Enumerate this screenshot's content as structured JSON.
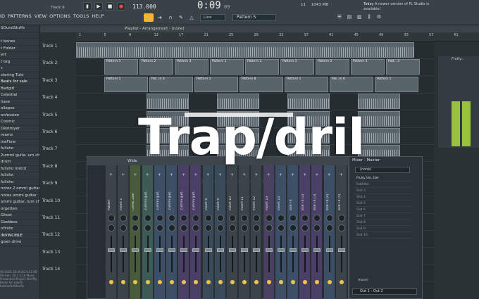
{
  "menu": [
    "ID",
    "PATTERNS",
    "VIEW",
    "OPTIONS",
    "TOOLS",
    "HELP"
  ],
  "top": {
    "track_hint": "Track 9",
    "bpm": "113.000",
    "time": "0:09",
    "time_sub": "09",
    "pattern": "Pattern 5",
    "mode": "Line",
    "cpu_memory": "1043 MB",
    "cpu_counter": "11",
    "news_label": "Today",
    "news_text": "A newer version of FL Studio is available!"
  },
  "browser": {
    "items": [
      "SOundStuffs",
      "",
      "t bones",
      "t Folder",
      "ert",
      "t Gig",
      "c",
      "stering Tuto",
      "Beats for sale",
      "Badgirl",
      "Celestial",
      "hase",
      "ollapse",
      "onfession",
      "Cosmic",
      "Destroyer",
      "reams",
      "ineFlow",
      "fullsho",
      "2ummi guita..um chords",
      "drum",
      "fullsho mstrd",
      "fullsho",
      "fullsho",
      "notes 2 ommi guitar",
      "notes ommi guitar",
      "ommi guitar..rum chords",
      "orgotten",
      "Ghost",
      "Goddess",
      "nfinite",
      "INVINCIBLE",
      "goen drive"
    ],
    "footer": "06-2025 20:46:02 6.42 KB · Version: 20.7.2.19 Music Production/Project Ider/My Beats for sale/In fullsho/fullsho.flp"
  },
  "playlist": {
    "title": "Playlist - Arrangement · (none)",
    "ruler": [
      "1",
      "5",
      "9",
      "13",
      "17",
      "21",
      "25",
      "29",
      "33",
      "37",
      "41",
      "45",
      "49",
      "53",
      "57",
      "61"
    ],
    "tracks": [
      "Track 1",
      "Track 2",
      "Track 3",
      "Track 4",
      "Track 5",
      "Track 6",
      "Track 7",
      "Track 8",
      "Track 9",
      "Track 10",
      "Track 11",
      "Track 12",
      "Track 13",
      "Track 14"
    ],
    "pattern_clips": [
      "Pattern 1",
      "Pattern 2",
      "Pattern 3",
      "Pattern 1",
      "Pattern 2",
      "Pattern 1",
      "Pattern 2",
      "Pattern 3",
      "Patt...3"
    ],
    "row3_clips": [
      "Pattern 1",
      "Pat..rn 6",
      "Pattern 1",
      "Pattern 8",
      "Pattern 1",
      "Pat..rn 6",
      "Pattern 1"
    ]
  },
  "mini_rack": {
    "title": "Fruity..."
  },
  "mixer": {
    "wide_label": "Wide",
    "channels": [
      "Master",
      "Insert 1",
      "Comb..ode",
      "Zummi guit..",
      "Zummi guit..",
      "Zummi guit..",
      "Zummi guit..",
      "Zummi guit..",
      "Insert 8",
      "Insert 9",
      "Insert 10",
      "Insert 11",
      "Insert 12",
      "Insert 13",
      "Insert 14",
      "808 FX",
      "808 FX (2)",
      "808 FX (3)",
      "808 FX (4)",
      "808 FX (5)"
    ],
    "master_title": "Mixer - Master",
    "master_select": "(none)",
    "slots": [
      "Fruity lim..tter",
      "Fabfilter",
      "Slot 3",
      "Slot 4",
      "Slot 5",
      "Slot 6",
      "Slot 7",
      "Slot 8",
      "Slot 9",
      "Slot 10"
    ],
    "footer_select": "(none)",
    "output": "Out 1 - Out 2"
  },
  "overlay": {
    "title": "Trap/dril"
  },
  "colors": {
    "accent": "#f2b632",
    "meter": "#97c23a",
    "record": "#e04848"
  }
}
